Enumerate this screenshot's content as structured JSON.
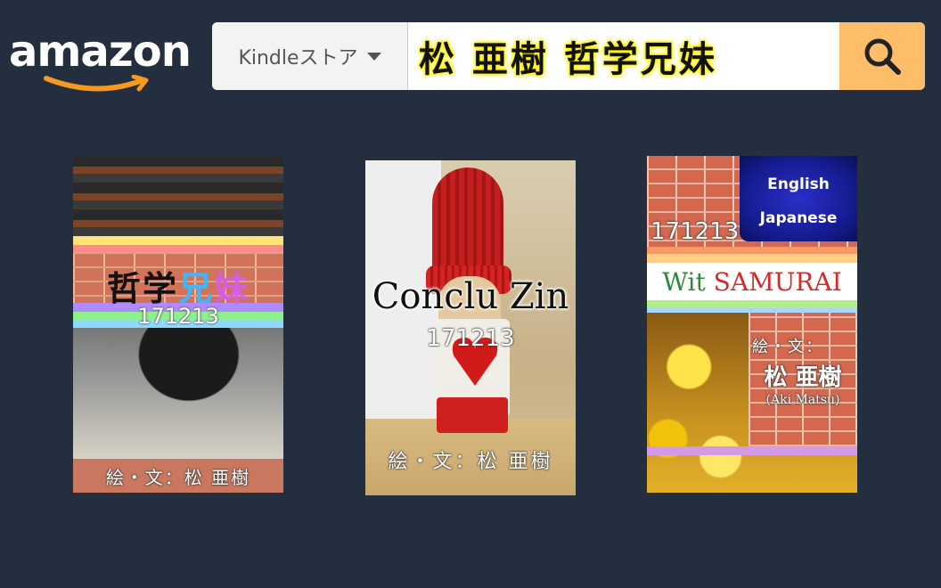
{
  "header": {
    "logo_text": "amazon",
    "category_label": "Kindleストア",
    "search_query": "松 亜樹 哲学兄妹",
    "colors": {
      "background": "#232f3e",
      "search_button": "#febd69",
      "logo_smile": "#f39a1f",
      "query_highlight": "#fff200"
    },
    "icons": {
      "search_button": "search-icon",
      "category_dropdown": "caret-down-icon"
    }
  },
  "covers": [
    {
      "title_part1": "哲学",
      "title_part2": "兄",
      "title_part3": "妹",
      "date": "171213",
      "author": "絵・文：松 亜樹"
    },
    {
      "title": "Conclu Zin",
      "date": "171213",
      "author": "絵・文：松 亜樹"
    },
    {
      "lang_top": "English",
      "lang_bottom": "Japanese",
      "date": "171213",
      "title_part1": "Wit",
      "title_part2": "SAMURAI",
      "author_label": "絵・文：",
      "author_name": "松 亜樹",
      "author_roman": "(Aki Matsu)"
    }
  ]
}
